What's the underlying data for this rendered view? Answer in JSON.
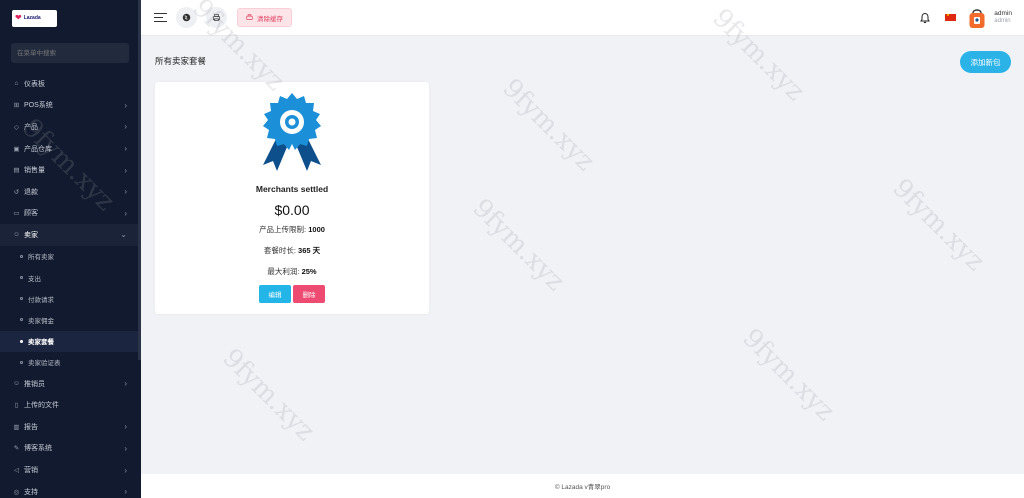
{
  "sidebar": {
    "logo_text": "Lazada",
    "search_placeholder": "在菜单中搜索",
    "items": [
      {
        "label": "仪表板",
        "icon": "home-icon",
        "has_children": false
      },
      {
        "label": "POS系统",
        "icon": "pos-icon",
        "has_children": true
      },
      {
        "label": "产品",
        "icon": "product-icon",
        "has_children": true
      },
      {
        "label": "产品仓库",
        "icon": "warehouse-icon",
        "has_children": true
      },
      {
        "label": "销售量",
        "icon": "sales-icon",
        "has_children": true
      },
      {
        "label": "退款",
        "icon": "refund-icon",
        "has_children": true
      },
      {
        "label": "顾客",
        "icon": "customer-icon",
        "has_children": true
      },
      {
        "label": "卖家",
        "icon": "user-icon",
        "has_children": true,
        "open": true
      },
      {
        "label": "推销员",
        "icon": "user-icon",
        "has_children": true
      },
      {
        "label": "上传的文件",
        "icon": "file-icon",
        "has_children": false
      },
      {
        "label": "报告",
        "icon": "report-icon",
        "has_children": true
      },
      {
        "label": "博客系统",
        "icon": "blog-icon",
        "has_children": true
      },
      {
        "label": "营销",
        "icon": "marketing-icon",
        "has_children": true
      },
      {
        "label": "支持",
        "icon": "support-icon",
        "has_children": true
      }
    ],
    "seller_sub_items": [
      {
        "label": "所有卖家",
        "active": false
      },
      {
        "label": "支出",
        "active": false
      },
      {
        "label": "付款请求",
        "active": false
      },
      {
        "label": "卖家佣金",
        "active": false
      },
      {
        "label": "卖家套餐",
        "active": true
      },
      {
        "label": "卖家验证表",
        "active": false
      }
    ]
  },
  "header": {
    "clear_cache_label": "清除缓存",
    "user_name": "admin",
    "user_role": "admin"
  },
  "main": {
    "page_title": "所有卖家套餐",
    "add_button_label": "添加新包",
    "package": {
      "name": "Merchants settled",
      "price": "$0.00",
      "upload_limit_label": "产品上传限制:",
      "upload_limit_value": "1000",
      "duration_label": "套餐时长:",
      "duration_value": "365 天",
      "max_profit_label": "最大利润:",
      "max_profit_value": "25%",
      "edit_label": "编辑",
      "delete_label": "删除"
    }
  },
  "footer": {
    "text": "© Lazada v青翠pro"
  },
  "watermark": "9fym.xyz",
  "colors": {
    "sidebar_bg": "#111a2e",
    "accent_blue": "#2bb3e8",
    "danger_pink": "#ee4b72",
    "clear_cache_bg": "#fde4e8"
  }
}
